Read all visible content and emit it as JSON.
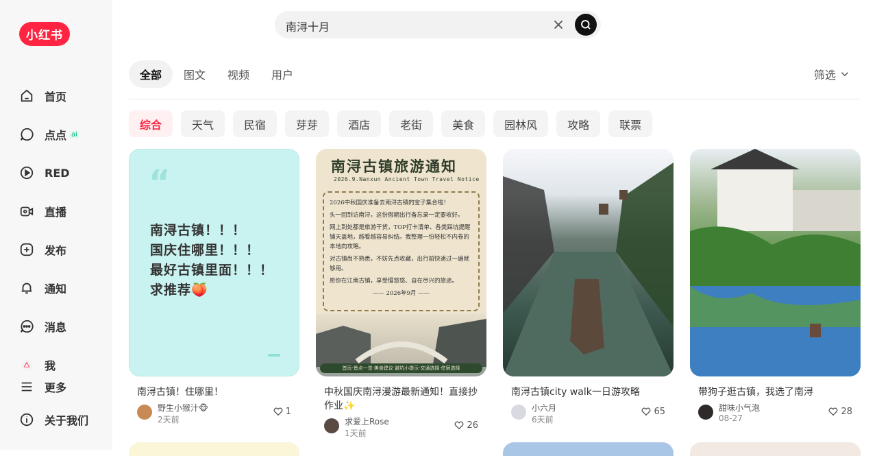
{
  "brand": {
    "logo_text": "小红书",
    "accent": "#ff2442"
  },
  "nav": [
    {
      "label": "首页",
      "icon": "home-icon"
    },
    {
      "label": "点点",
      "icon": "chat-bubble-icon",
      "badge": "ai"
    },
    {
      "label": "RED",
      "icon": "play-circle-icon"
    },
    {
      "label": "直播",
      "icon": "live-camera-icon"
    },
    {
      "label": "发布",
      "icon": "plus-square-icon"
    },
    {
      "label": "通知",
      "icon": "bell-icon"
    },
    {
      "label": "消息",
      "icon": "message-icon"
    },
    {
      "label": "我",
      "icon": "user-avatar-icon"
    },
    {
      "label": "更多",
      "icon": "menu-icon"
    },
    {
      "label": "关于我们",
      "icon": "info-icon"
    }
  ],
  "search": {
    "value": "南浔十月"
  },
  "tabs": [
    "全部",
    "图文",
    "视频",
    "用户"
  ],
  "filter_label": "筛选",
  "chips": [
    "综合",
    "天气",
    "民宿",
    "芽芽",
    "酒店",
    "老街",
    "美食",
    "园林风",
    "攻略",
    "联票"
  ],
  "cards": [
    {
      "cover_lines": [
        "南浔古镇！！！",
        "国庆住哪里！！！",
        "最好古镇里面！！！",
        "求推荐🍑"
      ],
      "title": "南浔古镇！住哪里！",
      "author": "野生小猴汁🐵",
      "time": "2天前",
      "likes": "1"
    },
    {
      "cover_title": "南浔古镇旅游通知",
      "cover_sub": "2026.9.Nanxun Ancient Town Travel Notice",
      "cover_body": [
        "2026中秋国庆准备去南浔古镇的宝子集合啦！",
        "头一回到访南浔，这份假期出行备忘录一定要收好。",
        "网上到处都是旅游干货，TOP打卡清单、各类踩坑提醒铺天盖地，越看越容易纠结。我整理一份轻松不内卷的本地向攻略。",
        "对古镇尚不熟悉，不妨先点收藏，出行前快速过一遍就够用。",
        "愿你在江南古镇，享受慢悠悠、自在尽兴的旅途。",
        "—— 2026年9月 ——"
      ],
      "cover_bar": "首页·景点一览·美食建议·避坑小提示·交通选择·住宿选择",
      "title": "中秋国庆南浔漫游最新通知！直接抄作业✨",
      "author": "求爱上Rose",
      "time": "1天前",
      "likes": "26"
    },
    {
      "title": "南浔古镇city walk一日游攻略",
      "author": "小六月",
      "time": "6天前",
      "likes": "65"
    },
    {
      "title": "带狗子逛古镇，我选了南浔",
      "author": "甜味小气泡",
      "time": "08-27",
      "likes": "28"
    }
  ]
}
